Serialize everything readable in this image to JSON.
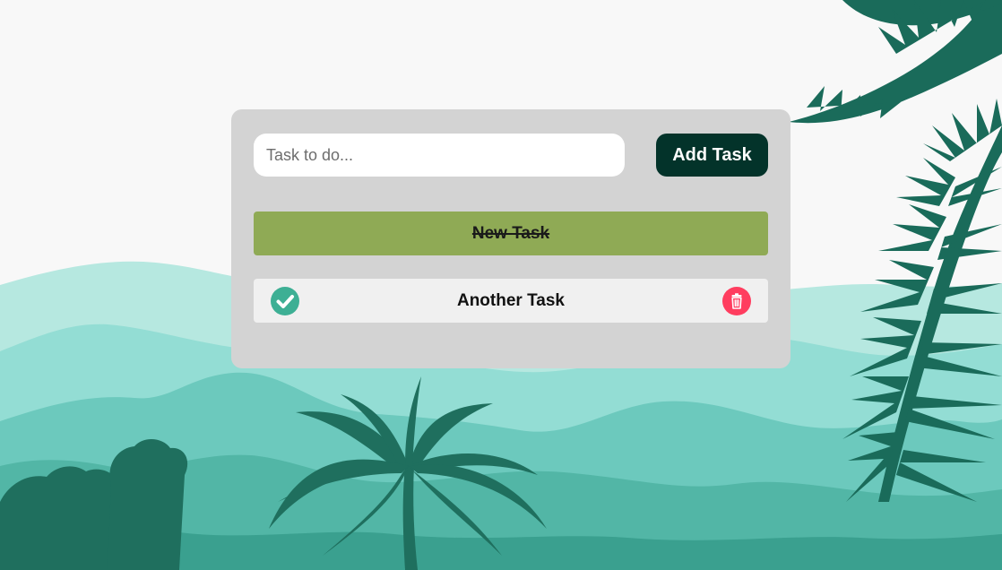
{
  "form": {
    "input_placeholder": "Task to do...",
    "input_value": "",
    "add_label": "Add Task"
  },
  "tasks": [
    {
      "label": "New Task",
      "completed": true
    },
    {
      "label": "Another Task",
      "completed": false
    }
  ],
  "icons": {
    "complete": "check-circle-icon",
    "delete": "trash-icon"
  },
  "colors": {
    "card_bg": "#d3d3d3",
    "add_button_bg": "#03332a",
    "completed_task_bg": "#8faa55",
    "pending_task_bg": "#f0f0f0",
    "check_icon": "#3daf94",
    "delete_icon": "#ff3d5f"
  }
}
